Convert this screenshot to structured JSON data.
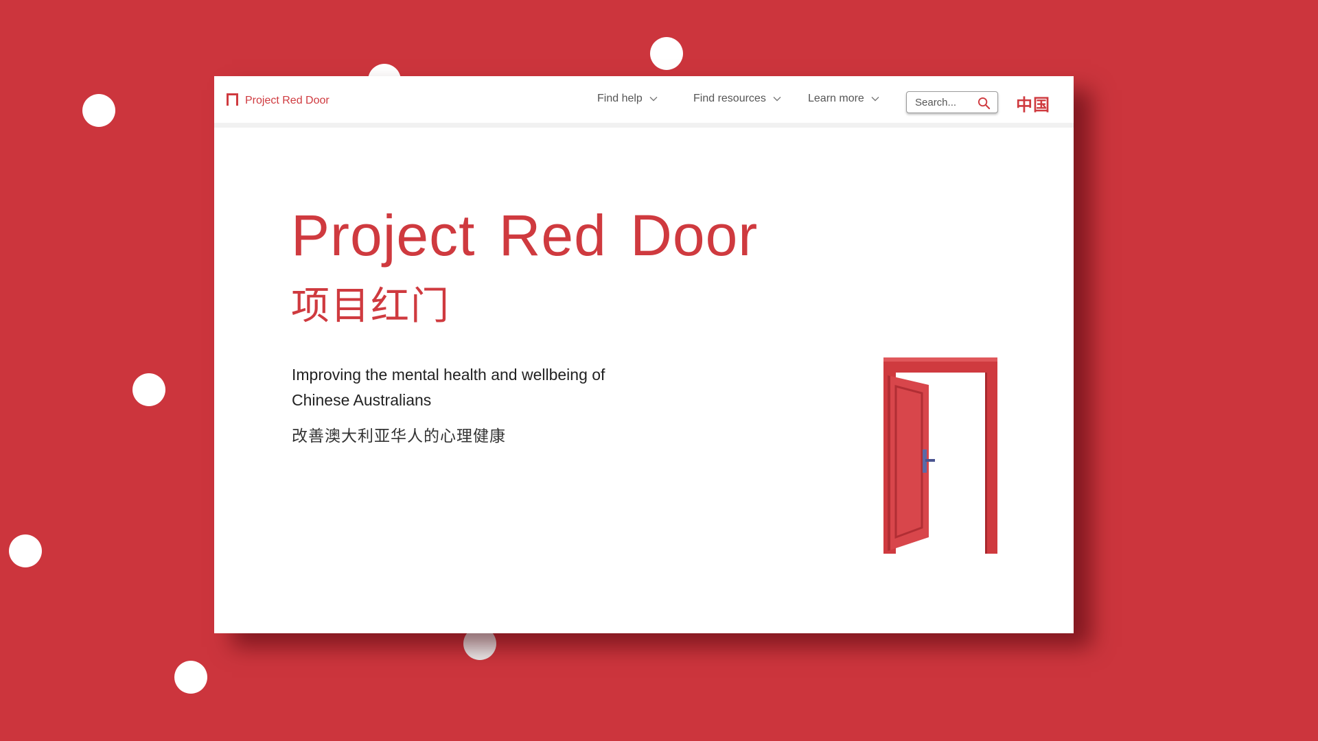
{
  "brand": {
    "name": "Project Red Door",
    "logo_icon": "door-frame-icon",
    "color": "#cf3a3f"
  },
  "nav": {
    "items": [
      {
        "label": "Find help",
        "icon": "chevron-down-icon"
      },
      {
        "label": "Find resources",
        "icon": "chevron-down-icon"
      },
      {
        "label": "Learn more",
        "icon": "chevron-down-icon"
      }
    ],
    "search": {
      "placeholder": "Search...",
      "icon": "search-icon"
    },
    "language_toggle": "中国"
  },
  "hero": {
    "title": "Project Red Door",
    "title_zh": "项目红门",
    "tagline": "Improving the mental health and wellbeing of Chinese Australians",
    "tagline_zh": "改善澳大利亚华人的心理健康",
    "illustration": "open-red-door"
  },
  "colors": {
    "background": "#cc353d",
    "accent": "#cf3a3f",
    "nav_text": "#555555",
    "body_text": "#222222"
  }
}
